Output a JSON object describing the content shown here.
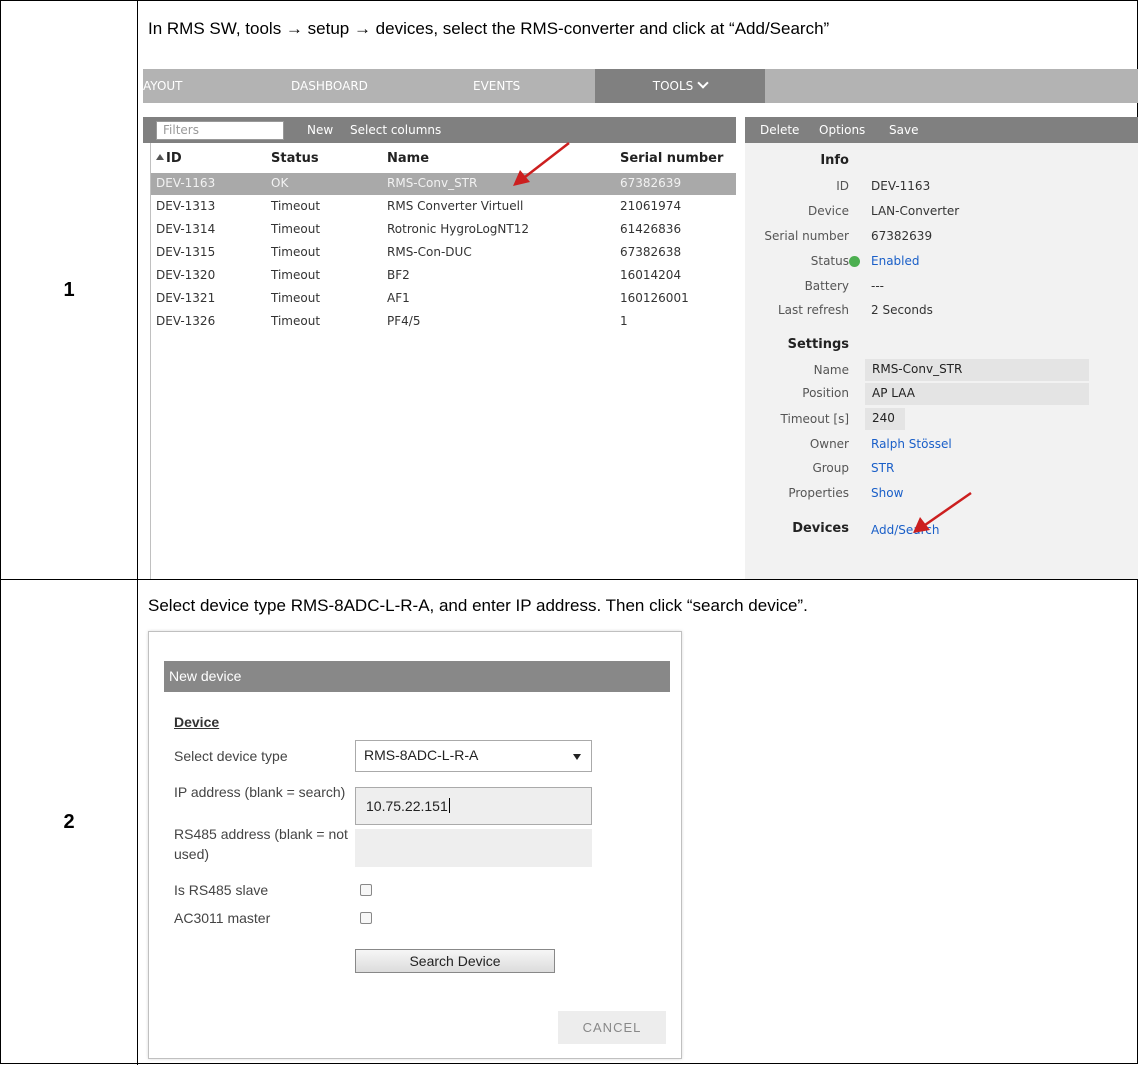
{
  "steps": [
    {
      "number": "1",
      "instruction": "In RMS SW, tools → setup → devices, select the RMS-converter and click at “Add/Search”"
    },
    {
      "number": "2",
      "instruction": "Select device type RMS-8ADC-L-R-A, and enter IP address. Then click “search device”."
    }
  ],
  "app": {
    "nav": {
      "layout": "AYOUT",
      "dashboard": "DASHBOARD",
      "events": "EVENTS",
      "tools": "TOOLS"
    },
    "list_toolbar": {
      "filters_placeholder": "Filters",
      "new": "New",
      "select_columns": "Select columns"
    },
    "columns": [
      "ID",
      "Status",
      "Name",
      "Serial number"
    ],
    "rows": [
      {
        "id": "DEV-1163",
        "status": "OK",
        "name": "RMS-Conv_STR",
        "serial": "67382639",
        "selected": true
      },
      {
        "id": "DEV-1313",
        "status": "Timeout",
        "name": "RMS Converter Virtuell",
        "serial": "21061974"
      },
      {
        "id": "DEV-1314",
        "status": "Timeout",
        "name": "Rotronic HygroLogNT12",
        "serial": "61426836"
      },
      {
        "id": "DEV-1315",
        "status": "Timeout",
        "name": "RMS-Con-DUC",
        "serial": "67382638"
      },
      {
        "id": "DEV-1320",
        "status": "Timeout",
        "name": "BF2",
        "serial": "16014204"
      },
      {
        "id": "DEV-1321",
        "status": "Timeout",
        "name": "AF1",
        "serial": "160126001"
      },
      {
        "id": "DEV-1326",
        "status": "Timeout",
        "name": "PF4/5",
        "serial": "1"
      }
    ],
    "detail_toolbar": {
      "delete": "Delete",
      "options": "Options",
      "save": "Save"
    },
    "info": {
      "heading": "Info",
      "id_label": "ID",
      "id_value": "DEV-1163",
      "device_label": "Device",
      "device_value": "LAN-Converter",
      "serial_label": "Serial number",
      "serial_value": "67382639",
      "status_label": "Status",
      "status_value": "Enabled",
      "status_color": "#4caf50",
      "battery_label": "Battery",
      "battery_value": "---",
      "refresh_label": "Last refresh",
      "refresh_value": "2 Seconds"
    },
    "settings": {
      "heading": "Settings",
      "name_label": "Name",
      "name_value": "RMS-Conv_STR",
      "position_label": "Position",
      "position_value": "AP LAA",
      "timeout_label": "Timeout [s]",
      "timeout_value": "240",
      "owner_label": "Owner",
      "owner_value": "Ralph Stössel",
      "group_label": "Group",
      "group_value": "STR",
      "properties_label": "Properties",
      "properties_value": "Show",
      "devices_label": "Devices",
      "devices_value": "Add/Search"
    },
    "accent_link": "#1a5fc8",
    "arrow_color": "#cc1f1f"
  },
  "dialog": {
    "title": "New device",
    "section": "Device",
    "device_type_label": "Select device type",
    "device_type_value": "RMS-8ADC-L-R-A",
    "ip_label": "IP address (blank = search)",
    "ip_value": "10.75.22.151",
    "rs485_label": "RS485 address (blank = not used)",
    "rs485_value": "",
    "rs485_slave_label": "Is RS485 slave",
    "rs485_slave_checked": false,
    "ac3011_label": "AC3011 master",
    "ac3011_checked": false,
    "search_button": "Search Device",
    "cancel_button": "CANCEL"
  }
}
